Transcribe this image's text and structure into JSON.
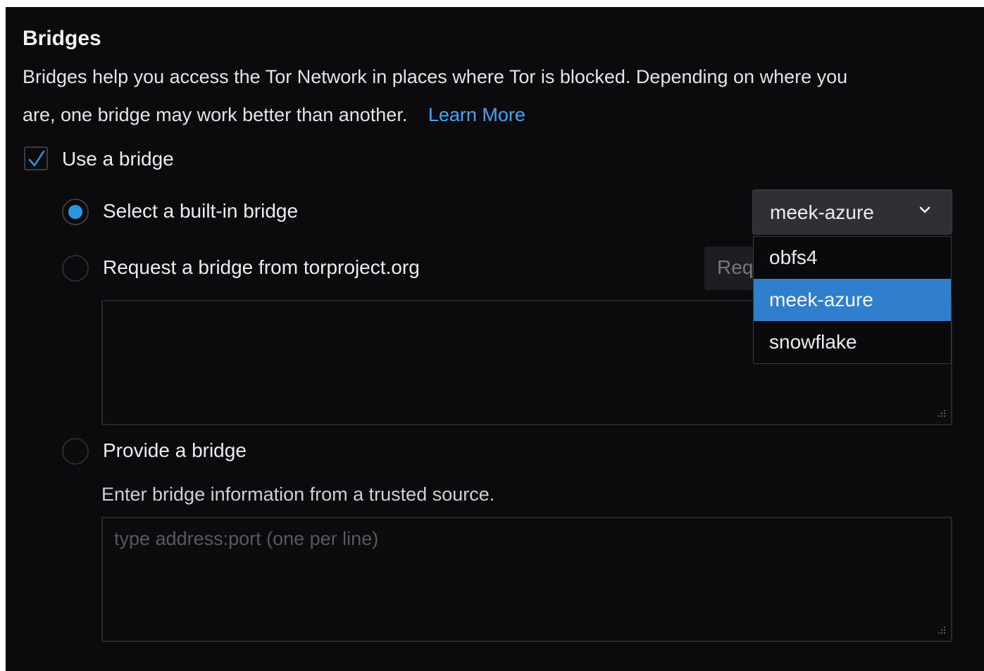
{
  "section": {
    "title": "Bridges",
    "description_line1": "Bridges help you access the Tor Network in places where Tor is blocked. Depending on where you",
    "description_line2": "are, one bridge may work better than another.",
    "learn_more": "Learn More"
  },
  "use_bridge": {
    "label": "Use a bridge",
    "checked": true
  },
  "options": {
    "builtin": {
      "label": "Select a built-in bridge",
      "selected": true
    },
    "request": {
      "label": "Request a bridge from torproject.org",
      "button_label": "Request a New Bridge…",
      "button_visible_text": "Req"
    },
    "provide": {
      "label": "Provide a bridge",
      "hint": "Enter bridge information from a trusted source.",
      "placeholder": "type address:port (one per line)"
    }
  },
  "bridge_select": {
    "value": "meek-azure",
    "options": [
      "obfs4",
      "meek-azure",
      "snowflake"
    ],
    "highlighted": "meek-azure"
  },
  "colors": {
    "background": "#0b0b0e",
    "accent": "#2b96e0",
    "link": "#46a4ee",
    "highlight": "#2f7fce"
  },
  "icons": {
    "checkbox": "checkmark-icon",
    "select": "chevron-down-icon",
    "textarea": "resize-grip-icon"
  }
}
